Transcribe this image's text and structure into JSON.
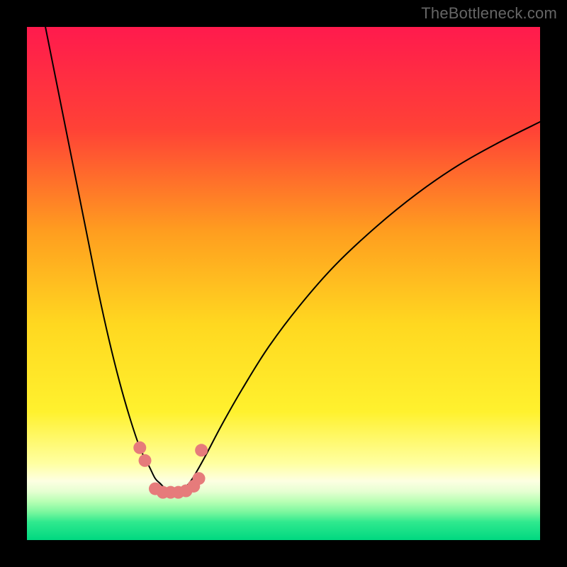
{
  "watermark": "TheBottleneck.com",
  "chart_data": {
    "type": "line",
    "title": "",
    "xlabel": "",
    "ylabel": "",
    "xlim": [
      0,
      100
    ],
    "ylim": [
      0,
      100
    ],
    "background_gradient": {
      "type": "vertical-linear",
      "stops": [
        {
          "pos": 0.0,
          "color": "#ff1a4d"
        },
        {
          "pos": 0.2,
          "color": "#ff4236"
        },
        {
          "pos": 0.4,
          "color": "#ff9e1f"
        },
        {
          "pos": 0.58,
          "color": "#ffd820"
        },
        {
          "pos": 0.75,
          "color": "#fff12e"
        },
        {
          "pos": 0.85,
          "color": "#ffffa0"
        },
        {
          "pos": 0.885,
          "color": "#fdffe2"
        },
        {
          "pos": 0.905,
          "color": "#e6ffd2"
        },
        {
          "pos": 0.925,
          "color": "#b7ffb4"
        },
        {
          "pos": 0.945,
          "color": "#7cf79f"
        },
        {
          "pos": 0.965,
          "color": "#2fe98e"
        },
        {
          "pos": 1.0,
          "color": "#00d880"
        }
      ]
    },
    "series": [
      {
        "name": "bottleneck-curve",
        "color": "#000000",
        "stroke_width": 2,
        "x": [
          0,
          2,
          4,
          6,
          8,
          10,
          12,
          14,
          16,
          18,
          20,
          22,
          23,
          24,
          25,
          26,
          27,
          28,
          29,
          30,
          31,
          32,
          33,
          35,
          38,
          42,
          47,
          53,
          60,
          68,
          76,
          84,
          92,
          100
        ],
        "y": [
          118,
          108,
          98,
          88,
          78,
          68,
          58,
          48,
          39,
          31,
          24,
          18,
          16,
          14,
          12,
          11,
          10,
          9.5,
          9.3,
          9.6,
          10.4,
          11.6,
          13.2,
          16.8,
          22.5,
          29.5,
          37.5,
          45.5,
          53.5,
          61.0,
          67.5,
          73.0,
          77.5,
          81.5
        ]
      }
    ],
    "markers": {
      "name": "highlighted-points",
      "color": "#e67b7b",
      "shape": "circle",
      "radius": 9,
      "points": [
        {
          "x": 22.0,
          "y": 18.0
        },
        {
          "x": 23.0,
          "y": 15.5
        },
        {
          "x": 25.0,
          "y": 10.0
        },
        {
          "x": 26.5,
          "y": 9.3
        },
        {
          "x": 28.0,
          "y": 9.3
        },
        {
          "x": 29.5,
          "y": 9.3
        },
        {
          "x": 31.0,
          "y": 9.6
        },
        {
          "x": 32.5,
          "y": 10.5
        },
        {
          "x": 33.5,
          "y": 12.0
        },
        {
          "x": 34.0,
          "y": 17.5
        }
      ]
    }
  }
}
